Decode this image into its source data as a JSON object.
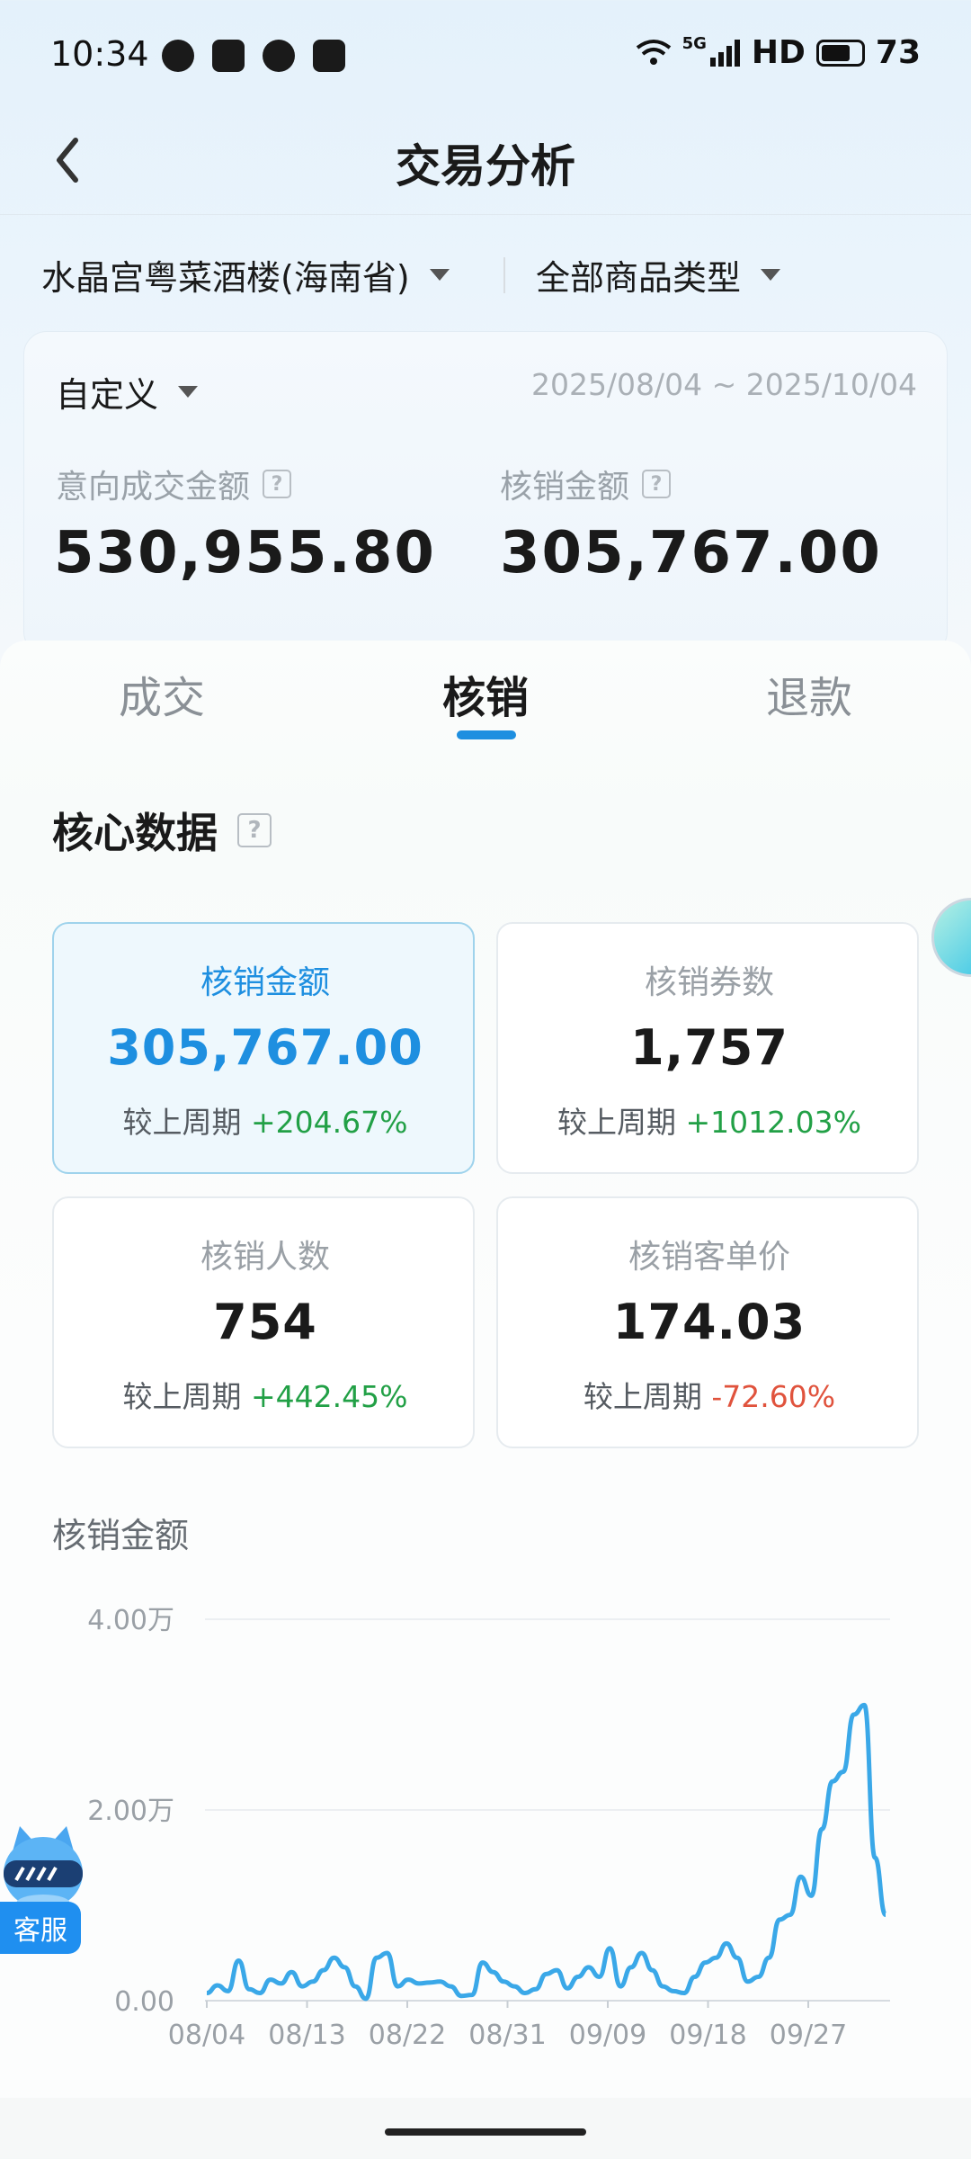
{
  "status_bar": {
    "time": "10:34",
    "network": "5G",
    "hd": "HD",
    "battery": "73",
    "battery_level": 0.73
  },
  "header": {
    "title": "交易分析",
    "back_icon": "chevron-left-icon"
  },
  "filters": {
    "store": "水晶宫粤菜酒楼(海南省)",
    "category": "全部商品类型"
  },
  "summary": {
    "range_type": "自定义",
    "date_range": "2025/08/04 ~ 2025/10/04",
    "intent_label": "意向成交金额",
    "intent_value": "530,955.80",
    "verified_label": "核销金额",
    "verified_value": "305,767.00"
  },
  "tabs": [
    {
      "label": "成交",
      "active": false
    },
    {
      "label": "核销",
      "active": true
    },
    {
      "label": "退款",
      "active": false
    }
  ],
  "core": {
    "title": "核心数据",
    "compare_label": "较上周期",
    "cards": [
      {
        "label": "核销金额",
        "value": "305,767.00",
        "change": "+204.67%",
        "trend": "up",
        "active": true
      },
      {
        "label": "核销券数",
        "value": "1,757",
        "change": "+1012.03%",
        "trend": "up",
        "active": false
      },
      {
        "label": "核销人数",
        "value": "754",
        "change": "+442.45%",
        "trend": "up",
        "active": false
      },
      {
        "label": "核销客单价",
        "value": "174.03",
        "change": "-72.60%",
        "trend": "down",
        "active": false
      }
    ]
  },
  "chart_title": "核销金额",
  "chart_data": {
    "type": "line",
    "y_tick_labels": [
      "4.00万",
      "2.00万",
      "0.00"
    ],
    "y_ticks": [
      40000,
      20000,
      0
    ],
    "ylim": [
      0,
      40000
    ],
    "x_tick_labels": [
      "08/04",
      "08/13",
      "08/22",
      "08/31",
      "09/09",
      "09/18",
      "09/27"
    ],
    "grid": true,
    "color": "#3aa8e8",
    "series": [
      {
        "values": [
          800,
          1600,
          1000,
          4200,
          1200,
          800,
          2200,
          1800,
          3000,
          1500,
          2000,
          3200,
          4500,
          3500,
          1500,
          200,
          4500,
          5000,
          1500,
          2200,
          1800,
          1900,
          2000,
          1500,
          500,
          600,
          4000,
          3000,
          2000,
          1500,
          800,
          1200,
          2800,
          3200,
          1300,
          2500,
          3500,
          2500,
          5500,
          1500,
          3500,
          5000,
          3200,
          1500,
          1000,
          800,
          2500,
          4000,
          4500,
          6000,
          4500,
          2000,
          2500,
          4500,
          8500,
          9000,
          13000,
          11000,
          18000,
          23000,
          24000,
          30000,
          31000,
          15000,
          9000
        ]
      }
    ]
  },
  "service": {
    "label": "客服"
  }
}
